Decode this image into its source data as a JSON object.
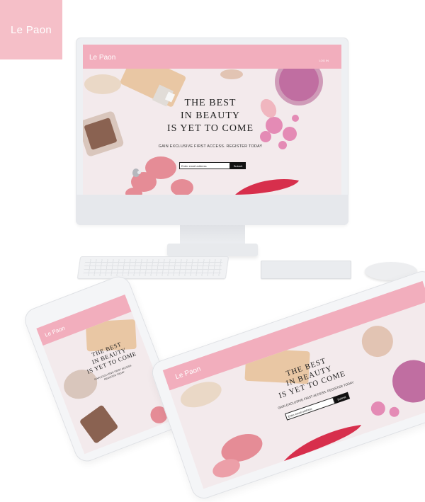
{
  "brand": {
    "name": "Le Paon"
  },
  "desktop": {
    "header": {
      "logo": "Le Paon",
      "login": "LOG IN"
    },
    "hero": {
      "title_line1": "THE BEST",
      "title_line2": "IN BEAUTY",
      "title_line3": "IS YET TO COME",
      "subtitle": "GAIN EXCLUSIVE FIRST ACCESS. REGISTER TODAY",
      "email_placeholder": "Enter email address",
      "submit_label": "Submit"
    }
  },
  "phone": {
    "logo": "Le Paon",
    "title_line1": "THE BEST",
    "title_line2": "IN BEAUTY",
    "title_line3": "IS YET TO COME",
    "subtitle_line1": "GAIN EXCLUSIVE FIRST ACCESS.",
    "subtitle_line2": "REGISTER TODAY"
  },
  "tablet": {
    "logo": "Le Paon",
    "title_line1": "THE BEST",
    "title_line2": "IN BEAUTY",
    "title_line3": "IS YET TO COME",
    "subtitle": "GAIN EXCLUSIVE FIRST ACCESS. REGISTER TODAY",
    "email_placeholder": "Enter email address",
    "submit_label": "Submit"
  },
  "colors": {
    "brand_pink": "#f2aebd",
    "hero_background": "#f3eaec",
    "submit_button": "#111111"
  }
}
